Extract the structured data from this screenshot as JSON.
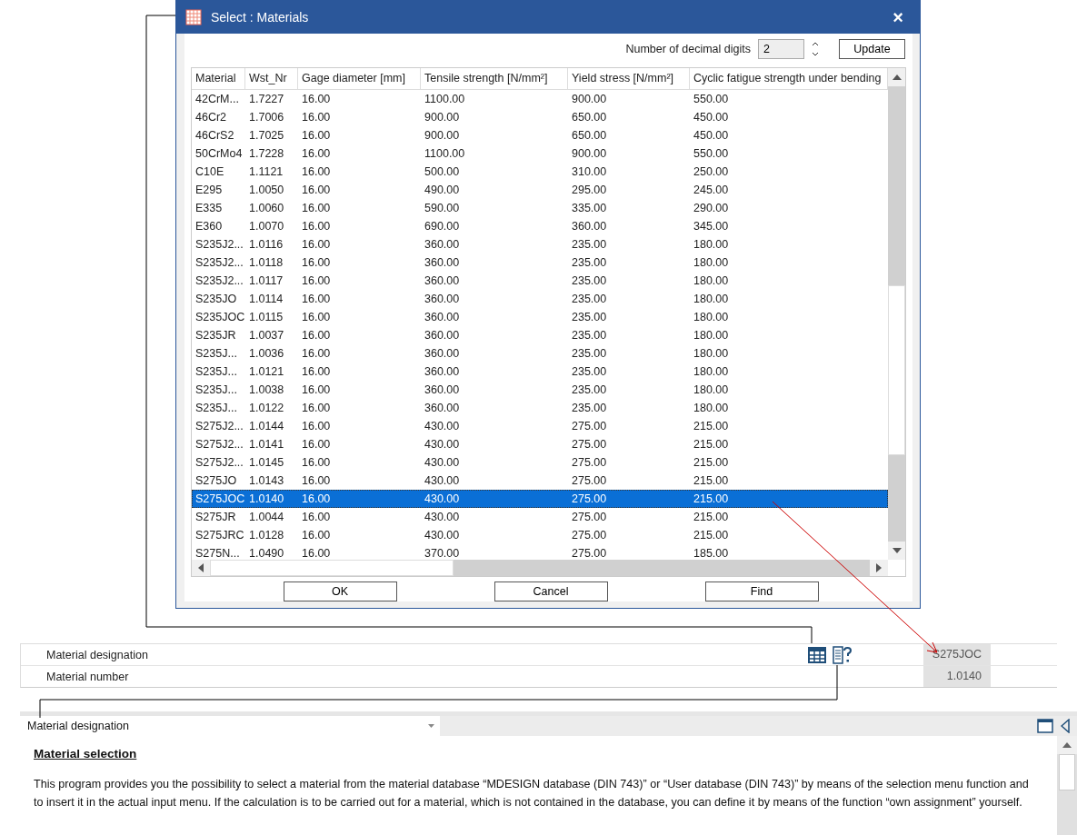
{
  "dialog": {
    "title": "Select : Materials",
    "close": "×",
    "decimal_digits": {
      "label": "Number of decimal digits",
      "value": "2"
    },
    "update_button": "Update",
    "table": {
      "columns": [
        "Material",
        "Wst_Nr",
        "Gage diameter [mm]",
        "Tensile strength [N/mm²]",
        "Yield stress [N/mm²]",
        "Cyclic fatigue strength under bending"
      ],
      "rows": [
        {
          "cells": [
            "42CrM...",
            "1.7227",
            "16.00",
            "1100.00",
            "900.00",
            "550.00"
          ],
          "selected": false
        },
        {
          "cells": [
            "46Cr2",
            "1.7006",
            "16.00",
            "900.00",
            "650.00",
            "450.00"
          ],
          "selected": false
        },
        {
          "cells": [
            "46CrS2",
            "1.7025",
            "16.00",
            "900.00",
            "650.00",
            "450.00"
          ],
          "selected": false
        },
        {
          "cells": [
            "50CrMo4",
            "1.7228",
            "16.00",
            "1100.00",
            "900.00",
            "550.00"
          ],
          "selected": false
        },
        {
          "cells": [
            "C10E",
            "1.1121",
            "16.00",
            "500.00",
            "310.00",
            "250.00"
          ],
          "selected": false
        },
        {
          "cells": [
            "E295",
            "1.0050",
            "16.00",
            "490.00",
            "295.00",
            "245.00"
          ],
          "selected": false
        },
        {
          "cells": [
            "E335",
            "1.0060",
            "16.00",
            "590.00",
            "335.00",
            "290.00"
          ],
          "selected": false
        },
        {
          "cells": [
            "E360",
            "1.0070",
            "16.00",
            "690.00",
            "360.00",
            "345.00"
          ],
          "selected": false
        },
        {
          "cells": [
            "S235J2...",
            "1.0116",
            "16.00",
            "360.00",
            "235.00",
            "180.00"
          ],
          "selected": false
        },
        {
          "cells": [
            "S235J2...",
            "1.0118",
            "16.00",
            "360.00",
            "235.00",
            "180.00"
          ],
          "selected": false
        },
        {
          "cells": [
            "S235J2...",
            "1.0117",
            "16.00",
            "360.00",
            "235.00",
            "180.00"
          ],
          "selected": false
        },
        {
          "cells": [
            "S235JO",
            "1.0114",
            "16.00",
            "360.00",
            "235.00",
            "180.00"
          ],
          "selected": false
        },
        {
          "cells": [
            "S235JOC",
            "1.0115",
            "16.00",
            "360.00",
            "235.00",
            "180.00"
          ],
          "selected": false
        },
        {
          "cells": [
            "S235JR",
            "1.0037",
            "16.00",
            "360.00",
            "235.00",
            "180.00"
          ],
          "selected": false
        },
        {
          "cells": [
            "S235J...",
            "1.0036",
            "16.00",
            "360.00",
            "235.00",
            "180.00"
          ],
          "selected": false
        },
        {
          "cells": [
            "S235J...",
            "1.0121",
            "16.00",
            "360.00",
            "235.00",
            "180.00"
          ],
          "selected": false
        },
        {
          "cells": [
            "S235J...",
            "1.0038",
            "16.00",
            "360.00",
            "235.00",
            "180.00"
          ],
          "selected": false
        },
        {
          "cells": [
            "S235J...",
            "1.0122",
            "16.00",
            "360.00",
            "235.00",
            "180.00"
          ],
          "selected": false
        },
        {
          "cells": [
            "S275J2...",
            "1.0144",
            "16.00",
            "430.00",
            "275.00",
            "215.00"
          ],
          "selected": false
        },
        {
          "cells": [
            "S275J2...",
            "1.0141",
            "16.00",
            "430.00",
            "275.00",
            "215.00"
          ],
          "selected": false
        },
        {
          "cells": [
            "S275J2...",
            "1.0145",
            "16.00",
            "430.00",
            "275.00",
            "215.00"
          ],
          "selected": false
        },
        {
          "cells": [
            "S275JO",
            "1.0143",
            "16.00",
            "430.00",
            "275.00",
            "215.00"
          ],
          "selected": false
        },
        {
          "cells": [
            "S275JOC",
            "1.0140",
            "16.00",
            "430.00",
            "275.00",
            "215.00"
          ],
          "selected": true
        },
        {
          "cells": [
            "S275JR",
            "1.0044",
            "16.00",
            "430.00",
            "275.00",
            "215.00"
          ],
          "selected": false
        },
        {
          "cells": [
            "S275JRC",
            "1.0128",
            "16.00",
            "430.00",
            "275.00",
            "215.00"
          ],
          "selected": false
        },
        {
          "cells": [
            "S275N...",
            "1.0490",
            "16.00",
            "370.00",
            "275.00",
            "185.00"
          ],
          "selected": false
        }
      ]
    },
    "buttons": [
      "OK",
      "Cancel",
      "Find"
    ]
  },
  "properties": [
    {
      "label": "Material designation",
      "value": "S275JOC"
    },
    {
      "label": "Material number",
      "value": "1.0140"
    }
  ],
  "help": {
    "topic": "Material designation",
    "heading": "Material selection",
    "paragraph": "This program provides you the possibility to select a material from the material database “MDESIGN database (DIN 743)” or “User database (DIN 743)” by means of the selection menu function and to insert it in the actual input menu. If the calculation is to be carried out for a material, which is not contained in the database, you can define it by means of the function “own assignment” yourself."
  }
}
